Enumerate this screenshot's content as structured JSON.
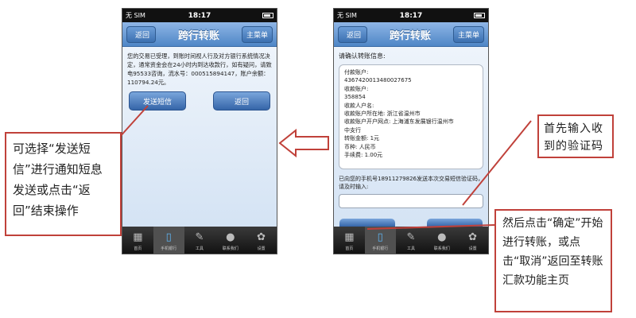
{
  "phone_left": {
    "status": {
      "carrier": "无 SIM",
      "time": "18:17"
    },
    "nav": {
      "back": "返回",
      "title": "跨行转账",
      "menu": "主菜单"
    },
    "message": "您的交易已受理，到账时间视人行及对方银行系统情况决定，通常资金会在24小时内到达收款行，如有疑问，请致电95533咨询，流水号：000515894147，账户余额：110794.24元。",
    "buttons": {
      "send_sms": "发送短信",
      "back": "返回"
    },
    "tabs": [
      {
        "label": "首页",
        "icon": "grid-icon"
      },
      {
        "label": "手机银行",
        "icon": "phone-icon"
      },
      {
        "label": "工具",
        "icon": "wrench-icon"
      },
      {
        "label": "联系我们",
        "icon": "chat-icon"
      },
      {
        "label": "设置",
        "icon": "gear-icon"
      }
    ]
  },
  "phone_right": {
    "status": {
      "carrier": "无 SIM",
      "time": "18:17"
    },
    "nav": {
      "back": "返回",
      "title": "跨行转账",
      "menu": "主菜单"
    },
    "confirm_title": "请确认转账信息:",
    "info_lines": [
      "付款账户:",
      "4367420013480027675",
      "收款账户:",
      "358854",
      "收款人户名:",
      "收款账户所在地: 浙江省温州市",
      "收款账户开户网点: 上海浦东发展银行温州市",
      "中支行",
      "转账金额: 1元",
      "币种: 人民币",
      "手续费: 1.00元"
    ],
    "sms_text": "已向您的手机号18911279826发送本次交易短信验证码，请及时输入:",
    "tabs": [
      {
        "label": "首页",
        "icon": "grid-icon"
      },
      {
        "label": "手机银行",
        "icon": "phone-icon"
      },
      {
        "label": "工具",
        "icon": "wrench-icon"
      },
      {
        "label": "联系我们",
        "icon": "chat-icon"
      },
      {
        "label": "设置",
        "icon": "gear-icon"
      }
    ]
  },
  "callouts": {
    "left": "可选择“发送短信”进行通知短息发送或点击“返回”结束操作",
    "top_right": "首先输入收到的验证码",
    "bottom_right": "然后点击“确定”开始进行转账，或点击“取消”返回至转账汇款功能主页"
  },
  "colors": {
    "accent": "#c0413a",
    "nav_blue": "#4e86c6"
  }
}
